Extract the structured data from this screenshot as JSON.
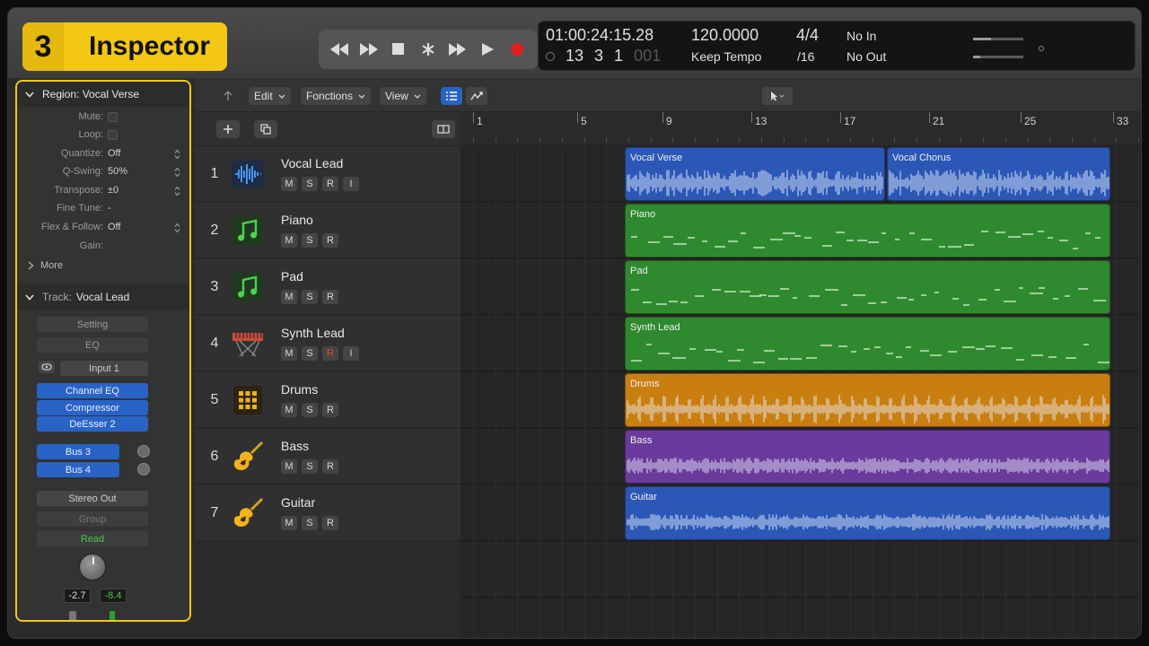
{
  "badge": {
    "number": "3",
    "title": "Inspector"
  },
  "transport": {
    "buttons": [
      "rewind-icon",
      "fast-forward-icon",
      "stop-icon",
      "capture-icon",
      "forward-to-end-icon",
      "play-icon",
      "record-icon"
    ],
    "colors": {
      "record": "#e01e1e"
    }
  },
  "lcd": {
    "timecode": "01:00:24:15.28",
    "bars": [
      "13",
      "3",
      "1",
      "001"
    ],
    "tempo": "120.0000",
    "tempo_mode": "Keep Tempo",
    "signature": "4/4",
    "division": "/16",
    "in": "No In",
    "out": "No Out"
  },
  "inspector": {
    "region_header": "Region: Vocal Verse",
    "region_params": [
      {
        "label": "Mute:",
        "type": "check"
      },
      {
        "label": "Loop:",
        "type": "check"
      },
      {
        "label": "Quantize:",
        "value": "Off",
        "stepper": true
      },
      {
        "label": "Q-Swing:",
        "value": "50%",
        "stepper": true
      },
      {
        "label": "Transpose:",
        "value": "±0",
        "stepper": true
      },
      {
        "label": "Fine Tune:",
        "value": "-"
      },
      {
        "label": "Flex & Follow:",
        "value": "Off",
        "stepper": true
      },
      {
        "label": "Gain:",
        "value": ""
      }
    ],
    "more": "More",
    "track_header_label": "Track:",
    "track_header_name": "Vocal Lead",
    "setting": "Setting",
    "eq": "EQ",
    "input": "Input 1",
    "plugins": [
      "Channel EQ",
      "Compressor",
      "DeEsser 2"
    ],
    "sends": [
      "Bus 3",
      "Bus 4"
    ],
    "output": "Stereo Out",
    "group": "Group",
    "automation": "Read",
    "volume_value": "-2.7",
    "peak_value": "-8.4"
  },
  "toolbar": {
    "edit": "Edit",
    "functions": "Fonctions",
    "view": "View"
  },
  "ruler": [
    "1",
    "5",
    "9",
    "13",
    "17",
    "21",
    "25",
    "33"
  ],
  "tracks": [
    {
      "num": "1",
      "name": "Vocal Lead",
      "buttons": [
        "M",
        "S",
        "R",
        "I"
      ],
      "icon": "waveform-icon"
    },
    {
      "num": "2",
      "name": "Piano",
      "buttons": [
        "M",
        "S",
        "R"
      ],
      "icon": "music-note-icon"
    },
    {
      "num": "3",
      "name": "Pad",
      "buttons": [
        "M",
        "S",
        "R"
      ],
      "icon": "music-note-icon"
    },
    {
      "num": "4",
      "name": "Synth Lead",
      "buttons": [
        "M",
        "S",
        "R",
        "I"
      ],
      "icon": "keyboard-icon",
      "record_armed": true
    },
    {
      "num": "5",
      "name": "Drums",
      "buttons": [
        "M",
        "S",
        "R"
      ],
      "icon": "drum-pad-icon"
    },
    {
      "num": "6",
      "name": "Bass",
      "buttons": [
        "M",
        "S",
        "R"
      ],
      "icon": "guitar-icon"
    },
    {
      "num": "7",
      "name": "Guitar",
      "buttons": [
        "M",
        "S",
        "R"
      ],
      "icon": "guitar-icon"
    }
  ],
  "regions": [
    {
      "track": 0,
      "name": "Vocal Verse",
      "kind": "audio",
      "color": "#2b57b6"
    },
    {
      "track": 0,
      "name": "Vocal Chorus",
      "kind": "audio",
      "color": "#2b57b6"
    },
    {
      "track": 1,
      "name": "Piano",
      "kind": "midi",
      "color": "#2f8a2f"
    },
    {
      "track": 2,
      "name": "Pad",
      "kind": "midi",
      "color": "#2f8a2f"
    },
    {
      "track": 3,
      "name": "Synth Lead",
      "kind": "midi",
      "color": "#2f8a2f"
    },
    {
      "track": 4,
      "name": "Drums",
      "kind": "audio",
      "color": "#c97e10"
    },
    {
      "track": 5,
      "name": "Bass",
      "kind": "audio",
      "color": "#6a3a9c"
    },
    {
      "track": 6,
      "name": "Guitar",
      "kind": "audio",
      "color": "#2b57b6"
    }
  ]
}
